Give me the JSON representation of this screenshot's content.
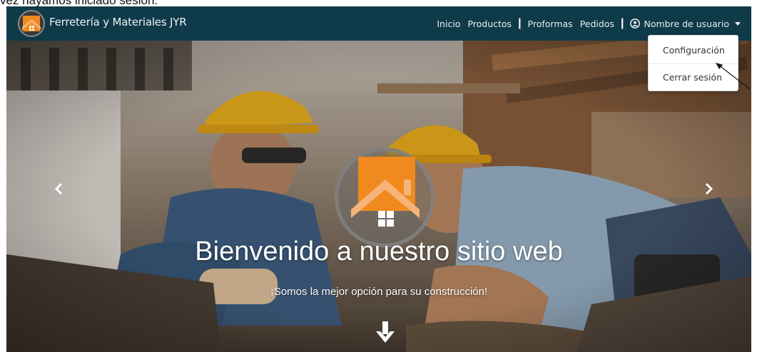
{
  "doc": {
    "caption_fragment": "vez hayamos iniciado sesión."
  },
  "navbar": {
    "brand": "Ferretería y Materiales JYR",
    "links": [
      "Inicio",
      "Productos",
      "Proformas",
      "Pedidos"
    ],
    "user_label": "Nombre de usuario",
    "icons": {
      "user": "user-circle-icon",
      "caret": "caret-down-icon",
      "brand": "house-logo-icon"
    }
  },
  "dropdown": {
    "items": [
      "Configuración",
      "Cerrar sesión"
    ]
  },
  "hero": {
    "title": "Bienvenido a nuestro sitio web",
    "subtitle": "¡Somos la mejor opción para su construcción!",
    "icons": {
      "prev": "chevron-left-icon",
      "next": "chevron-right-icon",
      "scroll": "arrow-down-icon"
    }
  },
  "colors": {
    "navbar_bg": "#0f3a4a",
    "accent_orange": "#f08a1e",
    "hero_text": "#ffffff"
  }
}
